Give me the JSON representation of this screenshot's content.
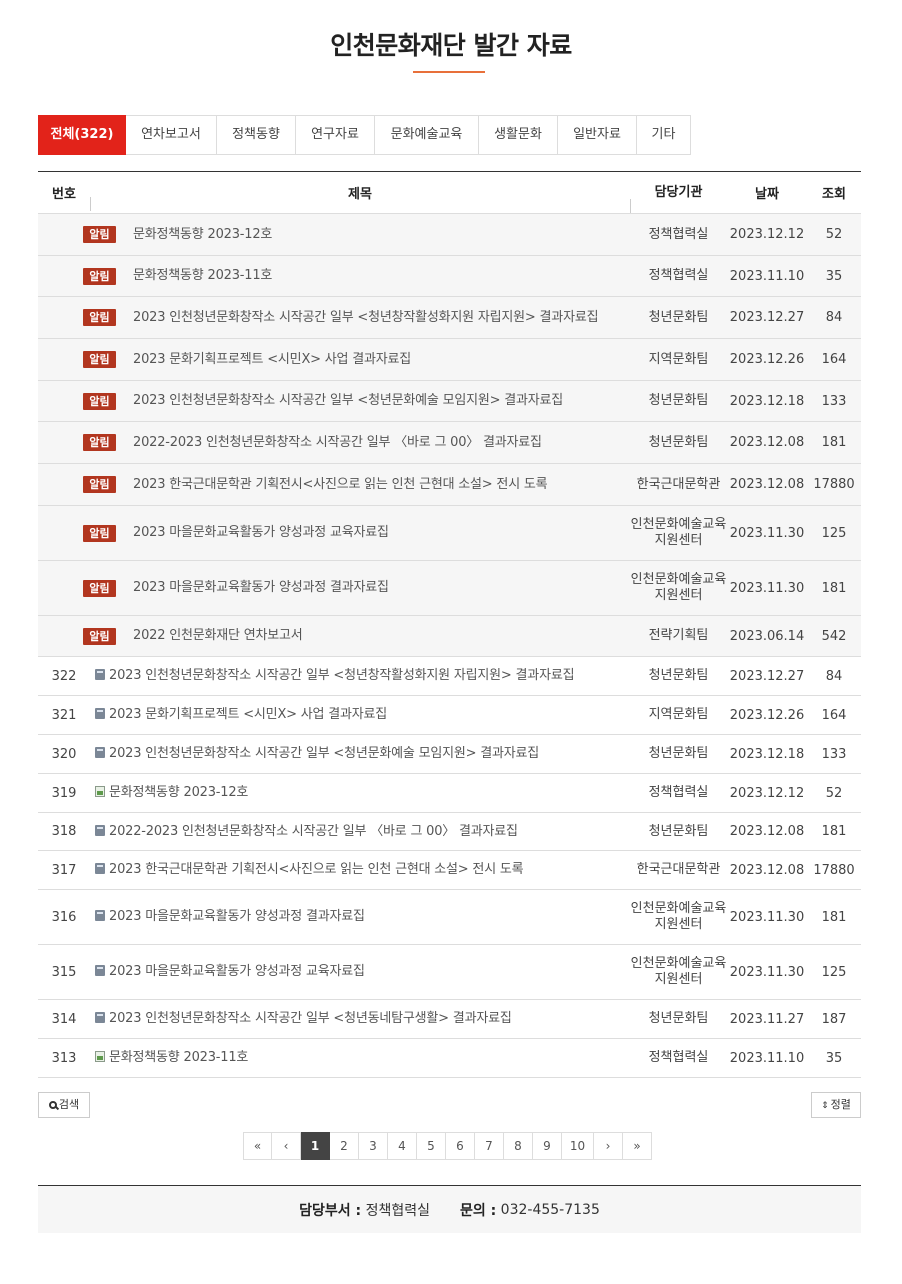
{
  "page": {
    "title": "인천문화재단 발간 자료"
  },
  "tabs": [
    {
      "label": "전체(322)",
      "active": true
    },
    {
      "label": "연차보고서"
    },
    {
      "label": "정책동향"
    },
    {
      "label": "연구자료"
    },
    {
      "label": "문화예술교육"
    },
    {
      "label": "생활문화"
    },
    {
      "label": "일반자료"
    },
    {
      "label": "기타"
    }
  ],
  "table": {
    "headers": {
      "num": "번호",
      "title": "제목",
      "dept": "담당기관",
      "date": "날짜",
      "hits": "조회"
    },
    "notice_label": "알림",
    "notices": [
      {
        "title": "문화정책동향 2023-12호",
        "dept": "정책협력실",
        "date": "2023.12.12",
        "hits": "52"
      },
      {
        "title": "문화정책동향 2023-11호",
        "dept": "정책협력실",
        "date": "2023.11.10",
        "hits": "35"
      },
      {
        "title": "2023 인천청년문화창작소 시작공간 일부 <청년창작활성화지원 자립지원> 결과자료집",
        "dept": "청년문화팀",
        "date": "2023.12.27",
        "hits": "84"
      },
      {
        "title": "2023 문화기획프로젝트 <시민X> 사업 결과자료집",
        "dept": "지역문화팀",
        "date": "2023.12.26",
        "hits": "164"
      },
      {
        "title": "2023 인천청년문화창작소 시작공간 일부 <청년문화예술 모임지원> 결과자료집",
        "dept": "청년문화팀",
        "date": "2023.12.18",
        "hits": "133"
      },
      {
        "title": "2022-2023 인천청년문화창작소 시작공간 일부 〈바로 그 00〉 결과자료집",
        "dept": "청년문화팀",
        "date": "2023.12.08",
        "hits": "181"
      },
      {
        "title": "2023 한국근대문학관 기획전시<사진으로 읽는 인천 근현대 소설> 전시 도록",
        "dept": "한국근대문학관",
        "date": "2023.12.08",
        "hits": "17880"
      },
      {
        "title": "2023 마을문화교육활동가 양성과정 교육자료집",
        "dept": "인천문화예술교육지원센터",
        "date": "2023.11.30",
        "hits": "125"
      },
      {
        "title": "2023 마을문화교육활동가 양성과정 결과자료집",
        "dept": "인천문화예술교육지원센터",
        "date": "2023.11.30",
        "hits": "181"
      },
      {
        "title": "2022 인천문화재단 연차보고서",
        "dept": "전략기획팀",
        "date": "2023.06.14",
        "hits": "542"
      }
    ],
    "posts": [
      {
        "num": "322",
        "icon": "document-icon",
        "title": "2023 인천청년문화창작소 시작공간 일부 <청년창작활성화지원 자립지원> 결과자료집",
        "dept": "청년문화팀",
        "date": "2023.12.27",
        "hits": "84"
      },
      {
        "num": "321",
        "icon": "document-icon",
        "title": "2023 문화기획프로젝트 <시민X> 사업 결과자료집",
        "dept": "지역문화팀",
        "date": "2023.12.26",
        "hits": "164"
      },
      {
        "num": "320",
        "icon": "document-icon",
        "title": "2023 인천청년문화창작소 시작공간 일부 <청년문화예술 모임지원> 결과자료집",
        "dept": "청년문화팀",
        "date": "2023.12.18",
        "hits": "133"
      },
      {
        "num": "319",
        "icon": "image-icon",
        "title": "문화정책동향 2023-12호",
        "dept": "정책협력실",
        "date": "2023.12.12",
        "hits": "52"
      },
      {
        "num": "318",
        "icon": "document-icon",
        "title": "2022-2023 인천청년문화창작소 시작공간 일부 〈바로 그 00〉 결과자료집",
        "dept": "청년문화팀",
        "date": "2023.12.08",
        "hits": "181"
      },
      {
        "num": "317",
        "icon": "document-icon",
        "title": "2023 한국근대문학관 기획전시<사진으로 읽는 인천 근현대 소설> 전시 도록",
        "dept": "한국근대문학관",
        "date": "2023.12.08",
        "hits": "17880"
      },
      {
        "num": "316",
        "icon": "document-icon",
        "title": "2023 마을문화교육활동가 양성과정 결과자료집",
        "dept": "인천문화예술교육지원센터",
        "date": "2023.11.30",
        "hits": "181"
      },
      {
        "num": "315",
        "icon": "document-icon",
        "title": "2023 마을문화교육활동가 양성과정 교육자료집",
        "dept": "인천문화예술교육지원센터",
        "date": "2023.11.30",
        "hits": "125"
      },
      {
        "num": "314",
        "icon": "document-icon",
        "title": "2023 인천청년문화창작소 시작공간 일부 <청년동네탐구생활> 결과자료집",
        "dept": "청년문화팀",
        "date": "2023.11.27",
        "hits": "187"
      },
      {
        "num": "313",
        "icon": "image-icon",
        "title": "문화정책동향 2023-11호",
        "dept": "정책협력실",
        "date": "2023.11.10",
        "hits": "35"
      }
    ]
  },
  "buttons": {
    "search": "검색",
    "sort": "정렬"
  },
  "pagination": {
    "first": "«",
    "prev": "‹",
    "next": "›",
    "last": "»",
    "pages": [
      "1",
      "2",
      "3",
      "4",
      "5",
      "6",
      "7",
      "8",
      "9",
      "10"
    ],
    "current": "1"
  },
  "footer": {
    "dept_label": "담당부서 :",
    "dept_value": "정책협력실",
    "contact_label": "문의 :",
    "contact_value": "032-455-7135"
  }
}
